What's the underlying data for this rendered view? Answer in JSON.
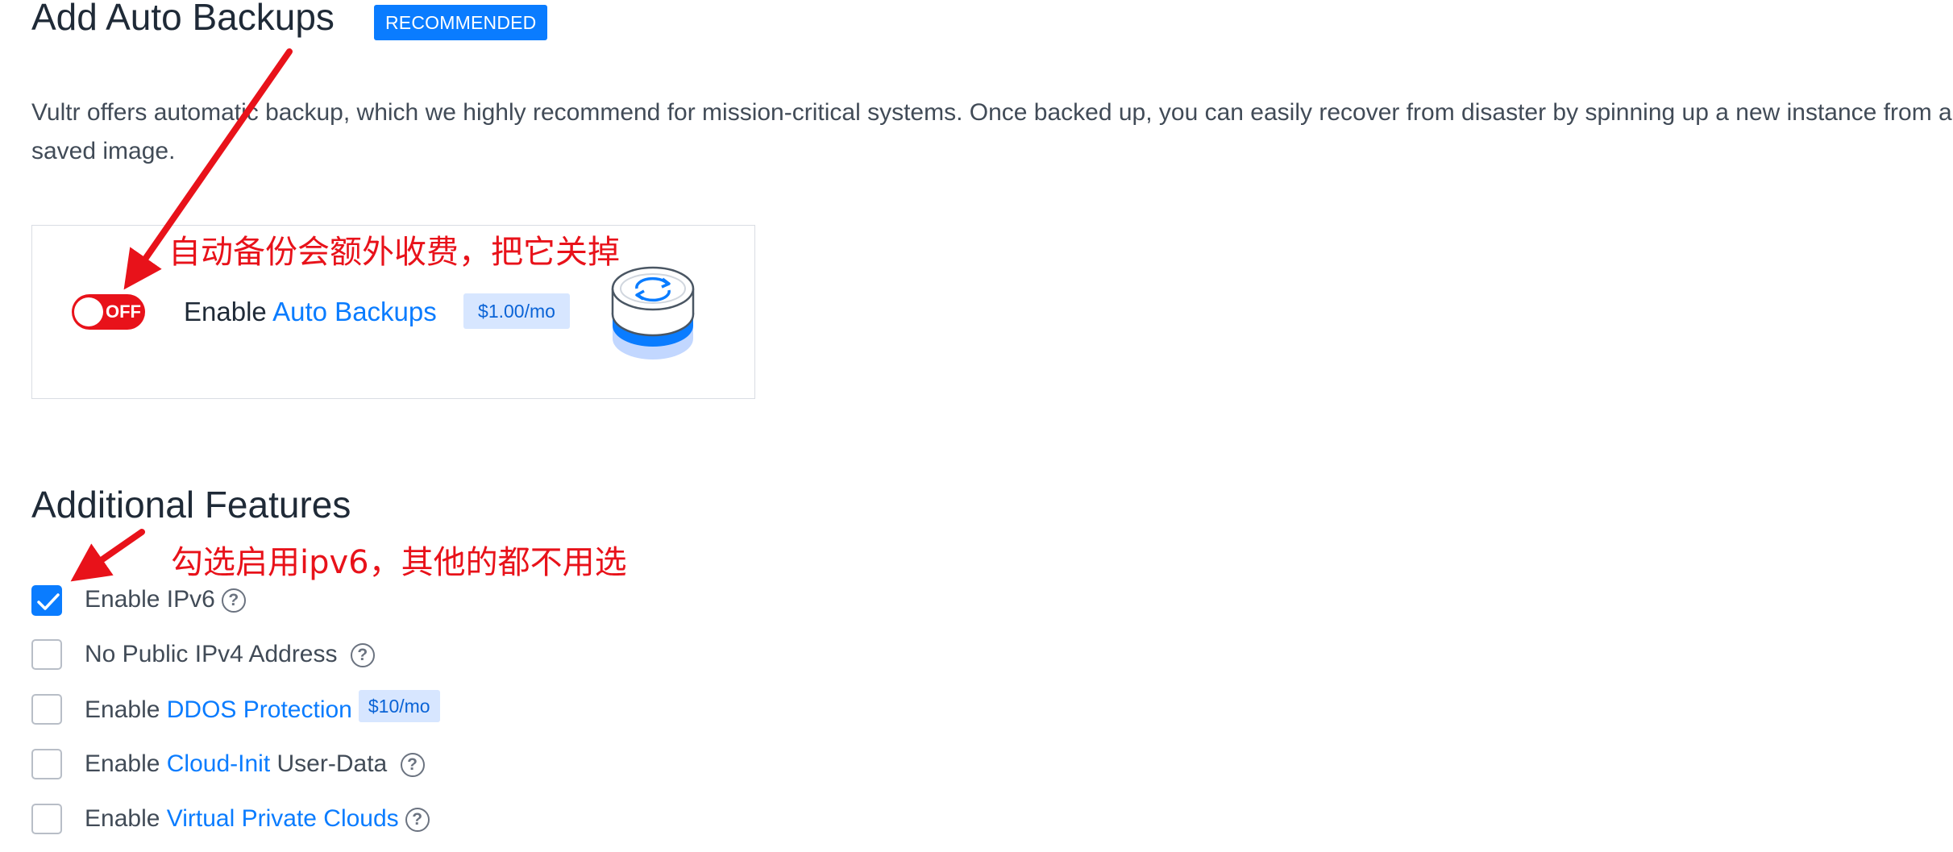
{
  "backups": {
    "title": "Add Auto Backups",
    "badge": "RECOMMENDED",
    "description_line1": "Vultr offers automatic backup, which we highly recommend for mission-critical systems. Once backed up, you can easily recover from disaster by spinning up a new instance from a",
    "description_line2": "saved image.",
    "toggle_state": "OFF",
    "enable_prefix": "Enable",
    "enable_link": "Auto Backups",
    "price": "$1.00/mo",
    "annotation": "自动备份会额外收费，把它关掉"
  },
  "additional": {
    "title": "Additional Features",
    "annotation": "勾选启用ipv6，其他的都不用选",
    "options": [
      {
        "prefix": "Enable IPv6",
        "checked": true
      },
      {
        "prefix": "No Public IPv4 Address",
        "checked": false
      },
      {
        "prefix": "Enable",
        "link": "DDOS Protection",
        "price": "$10/mo",
        "checked": false
      },
      {
        "prefix": "Enable",
        "link": "Cloud-Init",
        "suffix": "User-Data",
        "checked": false
      },
      {
        "prefix": "Enable",
        "link": "Virtual Private Clouds",
        "checked": false
      }
    ],
    "help_glyph": "?"
  },
  "colors": {
    "accent": "#0a7cff",
    "annotation": "#e8121a",
    "badge_bg": "#d7e6ff"
  }
}
